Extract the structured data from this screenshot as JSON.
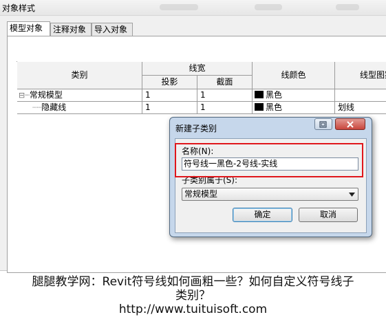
{
  "window": {
    "title": "对象样式"
  },
  "tabs": [
    {
      "label": "模型对象"
    },
    {
      "label": "注释对象"
    },
    {
      "label": "导入对象"
    }
  ],
  "table": {
    "col_category": "类别",
    "col_line_weight": "线宽",
    "col_projection": "投影",
    "col_cut": "截面",
    "col_line_color": "线颜色",
    "col_line_pattern": "线型图案",
    "rows": [
      {
        "tree": "⊟┈",
        "category": "常规模型",
        "projection": "1",
        "cut": "1",
        "color": "黑色",
        "pattern": ""
      },
      {
        "tree": "┈┈",
        "category": "隐藏线",
        "projection": "1",
        "cut": "1",
        "color": "黑色",
        "pattern": "划线"
      }
    ]
  },
  "dialog": {
    "title": "新建子类别",
    "name_label": "名称(N):",
    "name_value": "符号线一黑色-2号线-实线",
    "parent_label": "子类别属于(S):",
    "parent_value": "常规模型",
    "ok_label": "确定",
    "cancel_label": "取消"
  },
  "watermark": "tuituisoft",
  "caption": {
    "line1": "腿腿教学网：Revit符号线如何画粗一些？如何自定义符号线子",
    "line2": "类别？",
    "line3": "http://www.tuituisoft.com"
  },
  "colors": {
    "highlight": "#e0161b",
    "dialog_frame": "#c6d7eb",
    "close_button": "#c9463d"
  },
  "icons": [
    "restore-icon",
    "close-icon",
    "chevron-down-icon",
    "tree-collapse-icon"
  ]
}
